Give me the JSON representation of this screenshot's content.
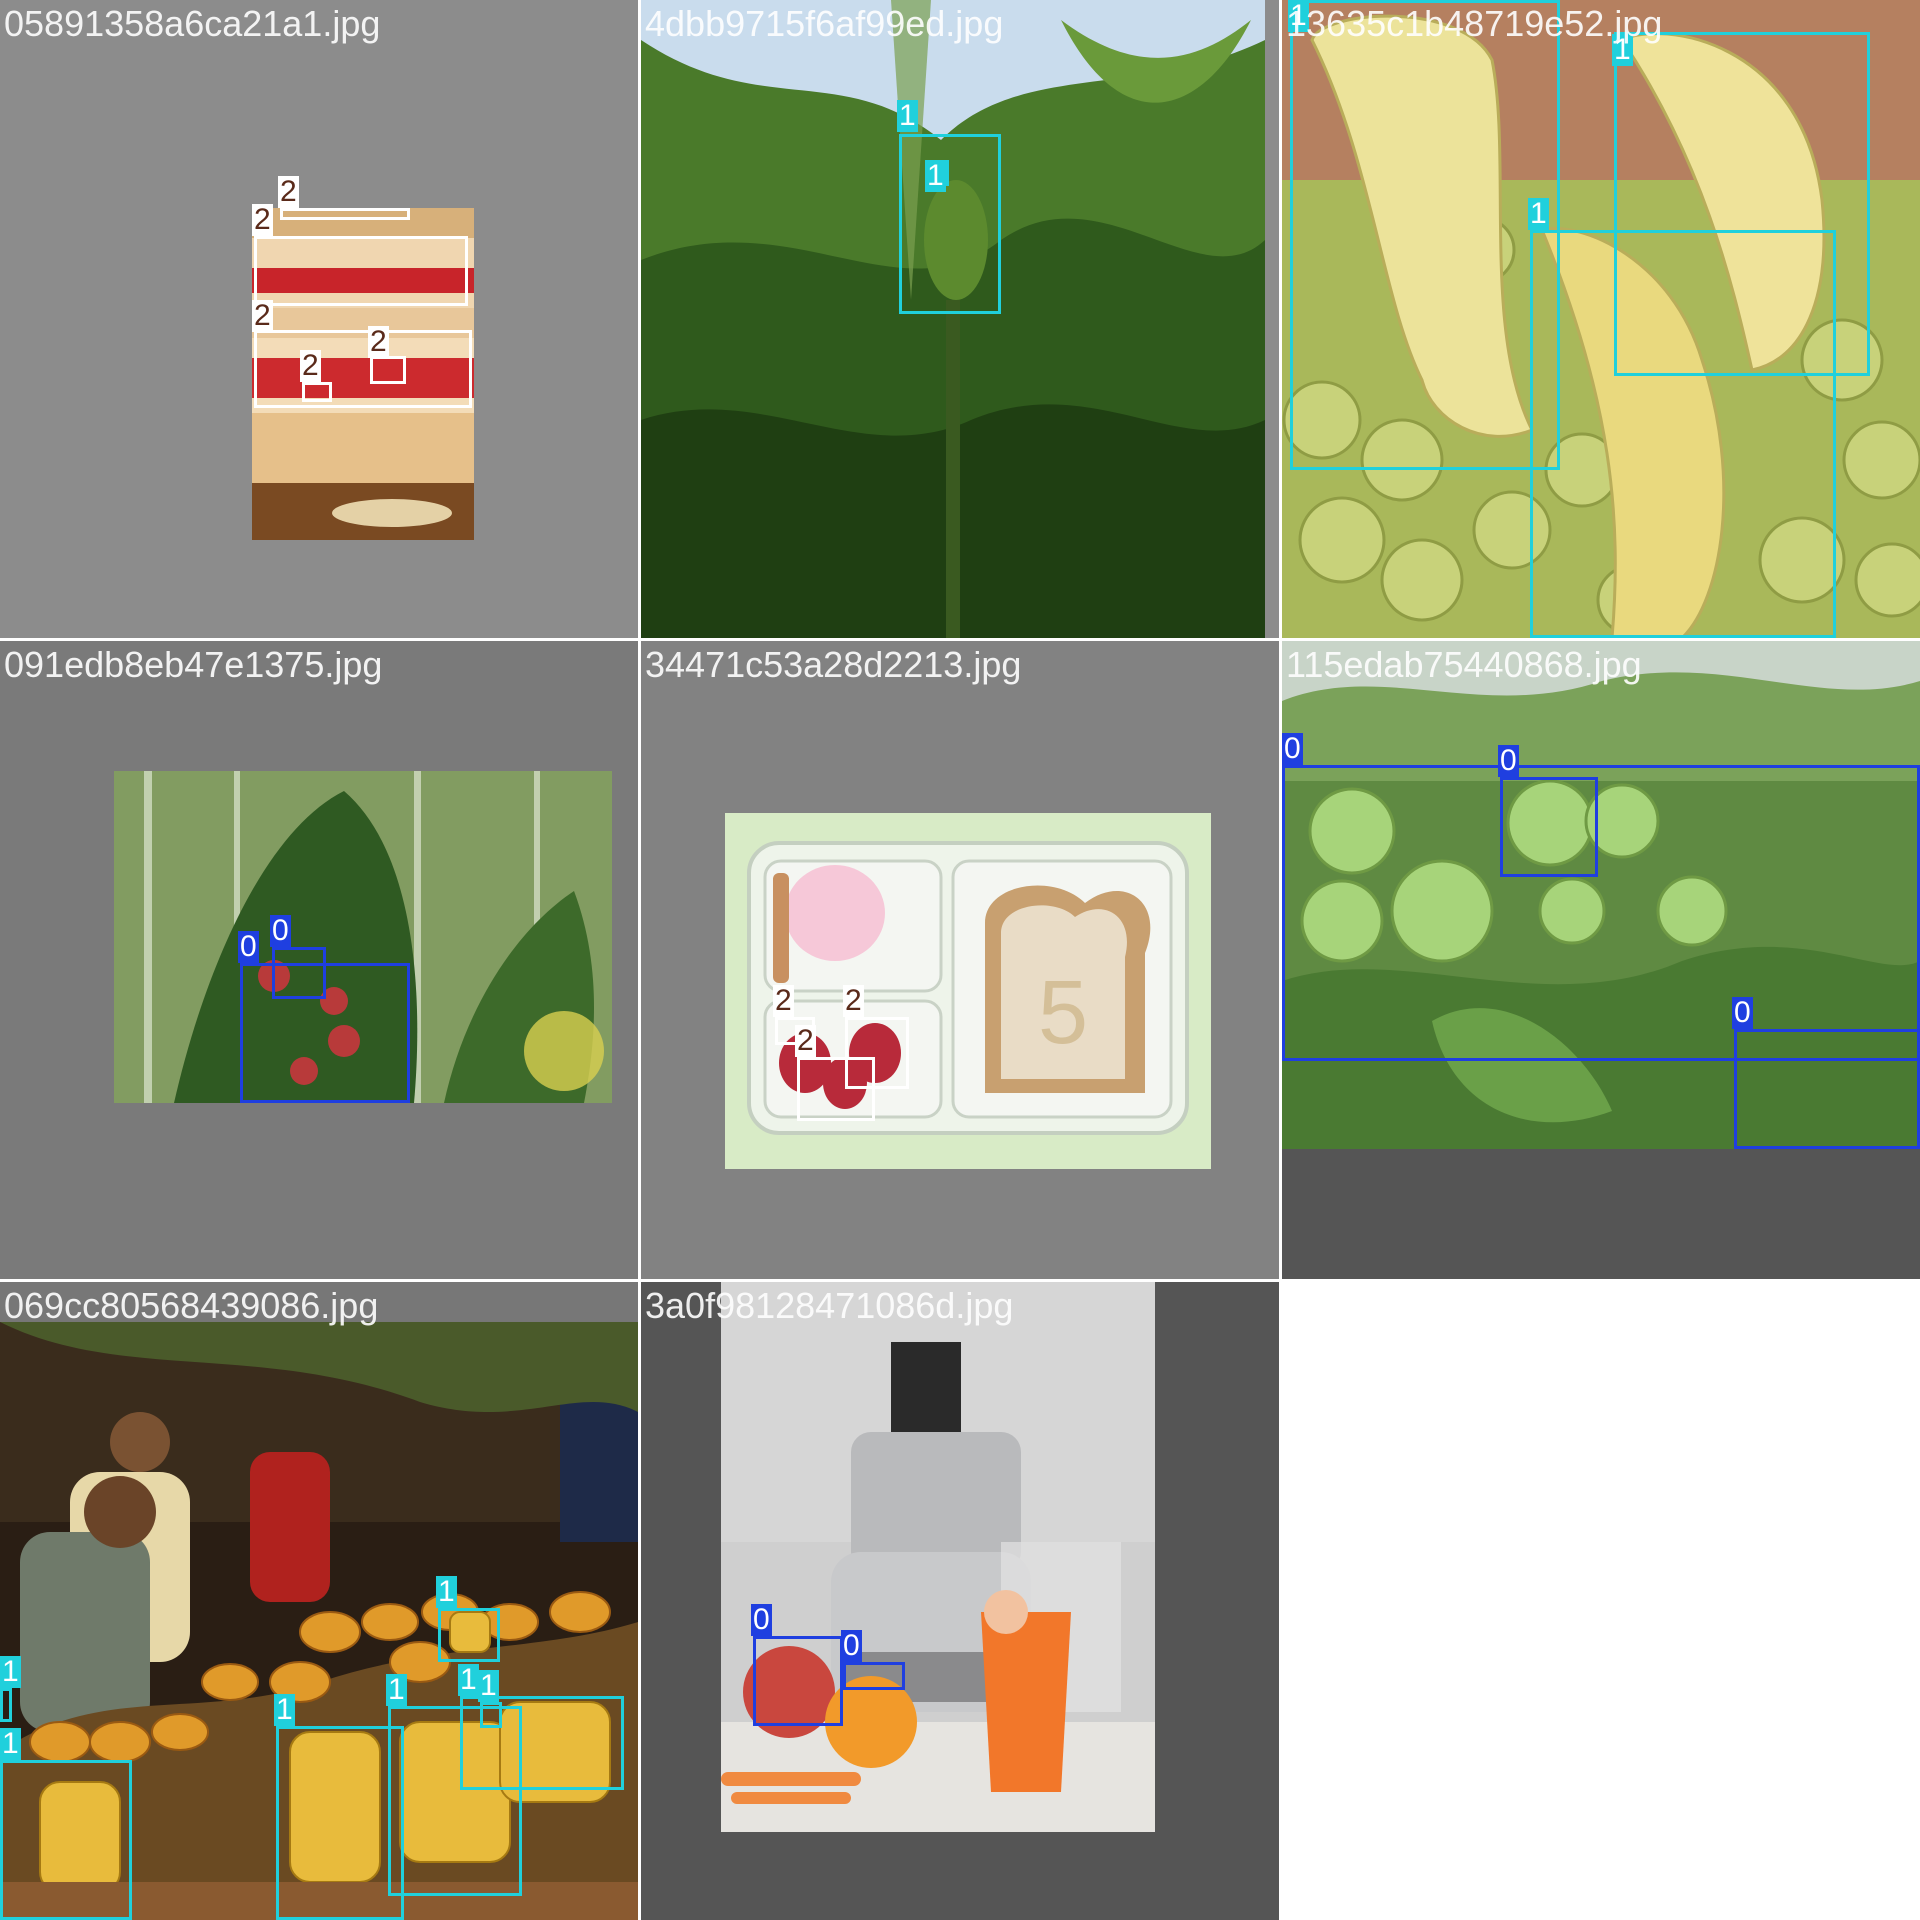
{
  "colors": {
    "class_0": "#1f3fe0",
    "class_1": "#20d0dc",
    "class_2": "#ffffff",
    "label_text_0": "#ffffff",
    "label_text_1": "#ffffff",
    "label_text_2": "#5a2a1a"
  },
  "tiles": [
    {
      "filename": "05891358a6ca21a1.jpg",
      "labels": [
        "2",
        "2",
        "2",
        "2",
        "2"
      ]
    },
    {
      "filename": "4dbb9715f6af99ed.jpg",
      "labels": [
        "1",
        "1"
      ]
    },
    {
      "filename": "13635c1b48719e52.jpg",
      "labels": [
        "1",
        "1",
        "1"
      ]
    },
    {
      "filename": "091edb8eb47e1375.jpg",
      "labels": [
        "0",
        "0"
      ]
    },
    {
      "filename": "34471c53a28d2213.jpg",
      "labels": [
        "2",
        "2",
        "2"
      ]
    },
    {
      "filename": "115edab75440868.jpg",
      "labels": [
        "0",
        "0",
        "0"
      ]
    },
    {
      "filename": "069cc80568439086.jpg",
      "labels": [
        "1",
        "1",
        "1",
        "1",
        "1",
        "1",
        "1"
      ]
    },
    {
      "filename": "3a0f98128471086d.jpg",
      "labels": [
        "0",
        "0"
      ]
    }
  ]
}
